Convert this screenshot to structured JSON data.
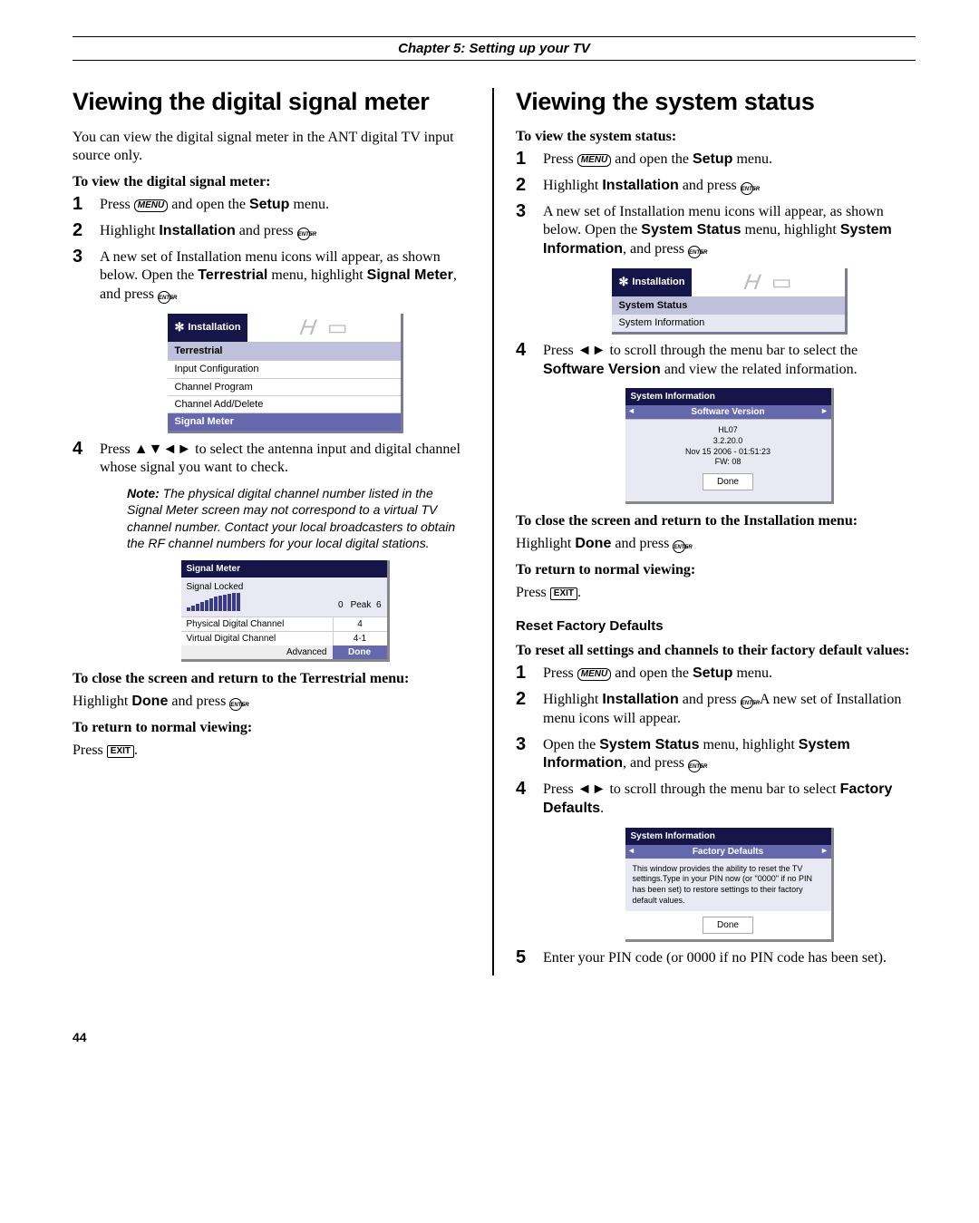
{
  "chapter": "Chapter 5: Setting up your TV",
  "page_num": "44",
  "left": {
    "title": "Viewing the digital signal meter",
    "intro": "You can view the digital signal meter in the ANT digital TV input source only.",
    "howto": "To view the digital signal meter:",
    "steps": {
      "s1a": "Press ",
      "s1b": " and open the ",
      "s1c": "Setup",
      "s1d": " menu.",
      "s2a": "Highlight ",
      "s2b": "Installation",
      "s2c": " and press ",
      "s3a": "A new set of Installation menu icons will appear, as shown below. Open the ",
      "s3b": "Terrestrial",
      "s3c": " menu, highlight ",
      "s3d": "Signal Meter",
      "s3e": ", and press ",
      "s4a": "Press ",
      "s4b": " to select the antenna input and digital channel whose signal you want to check."
    },
    "terr_menu": {
      "tab": "Installation",
      "header": "Terrestrial",
      "r1": "Input Configuration",
      "r2": "Channel Program",
      "r3": "Channel Add/Delete",
      "r4": "Signal Meter"
    },
    "note": {
      "label": "Note:",
      "text": " The physical digital channel number listed in the Signal Meter screen may not correspond to a virtual TV channel number. Contact your local broadcasters to obtain the RF channel numbers for your local digital stations."
    },
    "sigmeter": {
      "title": "Signal Meter",
      "locked": "Signal Locked",
      "val": "0",
      "peak_lbl": "Peak",
      "peak_val": "6",
      "r1": "Physical Digital Channel",
      "r1v": "4",
      "r2": "Virtual Digital Channel",
      "r2v": "4-1",
      "adv": "Advanced",
      "done": "Done"
    },
    "close_head": "To close the screen and return to the Terrestrial menu:",
    "close_a": "Highlight ",
    "close_b": "Done",
    "close_c": " and press ",
    "ret_head": "To return to normal viewing:",
    "ret_a": "Press "
  },
  "right": {
    "title": "Viewing the system status",
    "howto": "To view the system status:",
    "steps": {
      "s1a": "Press ",
      "s1b": " and open the ",
      "s1c": "Setup",
      "s1d": " menu.",
      "s2a": "Highlight ",
      "s2b": "Installation",
      "s2c": " and press ",
      "s3a": "A new set of Installation menu icons will appear, as shown below. Open the ",
      "s3b": "System Status",
      "s3c": " menu, highlight ",
      "s3d": "System Information",
      "s3e": ", and press ",
      "s4a": "Press ",
      "s4b": " to scroll through the menu bar to select the ",
      "s4c": "Software Version",
      "s4d": " and view the related information."
    },
    "sysmenu": {
      "tab": "Installation",
      "header": "System Status",
      "row": "System Information"
    },
    "sysinfo": {
      "title": "System Information",
      "bar": "Software Version",
      "l1": "HL07",
      "l2": "3.2.20.0",
      "l3": "Nov 15 2006 - 01:51:23",
      "l4": "FW:  08",
      "done": "Done"
    },
    "close_head": "To close the screen and return to the Installation menu:",
    "close_a": "Highlight ",
    "close_b": "Done",
    "close_c": " and press ",
    "ret_head": "To return to normal viewing:",
    "ret_a": "Press ",
    "rfd_head": "Reset Factory Defaults",
    "rfd_intro": "To reset all settings and channels to their factory default values:",
    "rfd_steps": {
      "s1a": "Press ",
      "s1b": " and open the ",
      "s1c": "Setup",
      "s1d": " menu.",
      "s2a": "Highlight ",
      "s2b": "Installation",
      "s2c": " and press ",
      "s2d": ". A new set of Installation menu icons will appear.",
      "s3a": "Open the ",
      "s3b": "System Status",
      "s3c": " menu, highlight ",
      "s3d": "System Information",
      "s3e": ", and press ",
      "s4a": "Press ",
      "s4b": " to scroll through the menu bar to select ",
      "s4c": "Factory Defaults",
      "s4d": ".",
      "s5a": "Enter your PIN code (or 0000 if no PIN code has been set)."
    },
    "factory": {
      "title": "System Information",
      "bar": "Factory Defaults",
      "text": "This window provides the ability to reset the TV settings.Type in your PIN now  (or \"0000\"  if no PIN has been set) to restore settings to their factory default values.",
      "done": "Done"
    }
  },
  "icons": {
    "menu": "MENU",
    "enter": "ENTER",
    "exit": "EXIT"
  }
}
